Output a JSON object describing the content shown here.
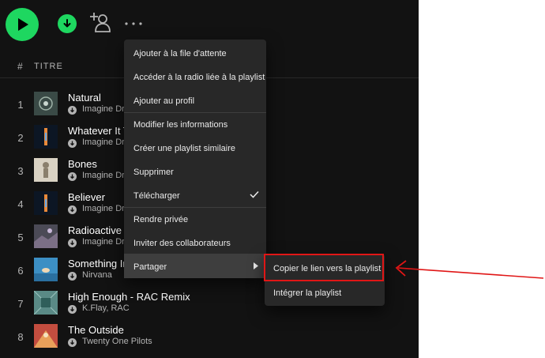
{
  "toolbar": {
    "play_icon": "play-icon",
    "download_icon": "download-icon",
    "add_user_icon": "add-user-icon",
    "more_icon": "more-options-icon"
  },
  "header": {
    "num_label": "#",
    "title_label": "TITRE"
  },
  "tracks": [
    {
      "num": "1",
      "title": "Natural",
      "artist": "Imagine Dr"
    },
    {
      "num": "2",
      "title": "Whatever It T",
      "artist": "Imagine Dr"
    },
    {
      "num": "3",
      "title": "Bones",
      "artist": "Imagine Dr"
    },
    {
      "num": "4",
      "title": "Believer",
      "artist": "Imagine Dr"
    },
    {
      "num": "5",
      "title": "Radioactive",
      "artist": "Imagine Dr"
    },
    {
      "num": "6",
      "title": "Something In",
      "artist": "Nirvana"
    },
    {
      "num": "7",
      "title": "High Enough - RAC Remix",
      "artist": "K.Flay, RAC"
    },
    {
      "num": "8",
      "title": "The Outside",
      "artist": "Twenty One Pilots"
    }
  ],
  "menu": {
    "items": [
      {
        "label": "Ajouter à la file d'attente"
      },
      {
        "label": "Accéder à la radio liée à la playlist"
      },
      {
        "label": "Ajouter au profil"
      },
      {
        "label": "Modifier les informations"
      },
      {
        "label": "Créer une playlist similaire"
      },
      {
        "label": "Supprimer"
      },
      {
        "label": "Télécharger"
      },
      {
        "label": "Rendre privée"
      },
      {
        "label": "Inviter des collaborateurs"
      },
      {
        "label": "Partager"
      }
    ]
  },
  "submenu": {
    "items": [
      {
        "label": "Copier le lien vers la playlist"
      },
      {
        "label": "Intégrer la playlist"
      }
    ]
  },
  "colors": {
    "accent": "#1ed760",
    "background": "#121212",
    "menu_bg": "#282828",
    "annotation_red": "#e01616"
  }
}
